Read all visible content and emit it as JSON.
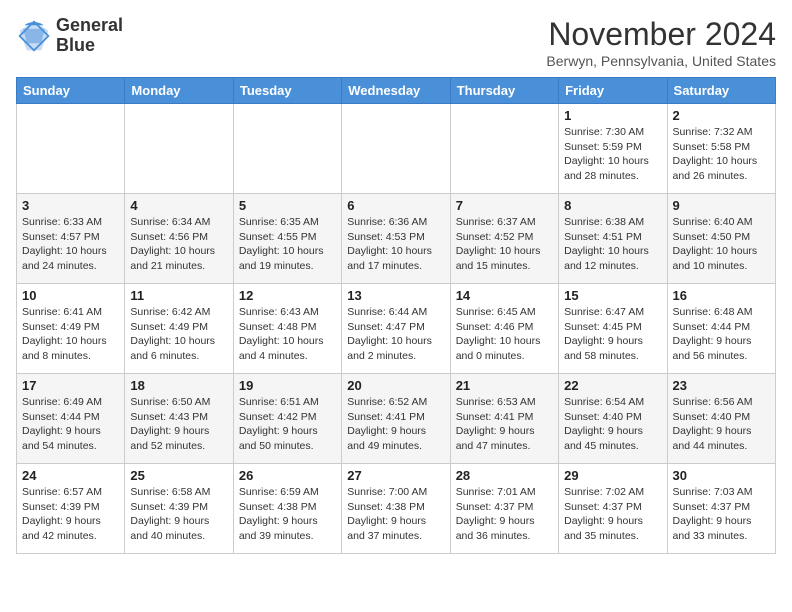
{
  "logo": {
    "line1": "General",
    "line2": "Blue"
  },
  "title": "November 2024",
  "location": "Berwyn, Pennsylvania, United States",
  "days_of_week": [
    "Sunday",
    "Monday",
    "Tuesday",
    "Wednesday",
    "Thursday",
    "Friday",
    "Saturday"
  ],
  "weeks": [
    [
      {
        "day": "",
        "info": ""
      },
      {
        "day": "",
        "info": ""
      },
      {
        "day": "",
        "info": ""
      },
      {
        "day": "",
        "info": ""
      },
      {
        "day": "",
        "info": ""
      },
      {
        "day": "1",
        "info": "Sunrise: 7:30 AM\nSunset: 5:59 PM\nDaylight: 10 hours and 28 minutes."
      },
      {
        "day": "2",
        "info": "Sunrise: 7:32 AM\nSunset: 5:58 PM\nDaylight: 10 hours and 26 minutes."
      }
    ],
    [
      {
        "day": "3",
        "info": "Sunrise: 6:33 AM\nSunset: 4:57 PM\nDaylight: 10 hours and 24 minutes."
      },
      {
        "day": "4",
        "info": "Sunrise: 6:34 AM\nSunset: 4:56 PM\nDaylight: 10 hours and 21 minutes."
      },
      {
        "day": "5",
        "info": "Sunrise: 6:35 AM\nSunset: 4:55 PM\nDaylight: 10 hours and 19 minutes."
      },
      {
        "day": "6",
        "info": "Sunrise: 6:36 AM\nSunset: 4:53 PM\nDaylight: 10 hours and 17 minutes."
      },
      {
        "day": "7",
        "info": "Sunrise: 6:37 AM\nSunset: 4:52 PM\nDaylight: 10 hours and 15 minutes."
      },
      {
        "day": "8",
        "info": "Sunrise: 6:38 AM\nSunset: 4:51 PM\nDaylight: 10 hours and 12 minutes."
      },
      {
        "day": "9",
        "info": "Sunrise: 6:40 AM\nSunset: 4:50 PM\nDaylight: 10 hours and 10 minutes."
      }
    ],
    [
      {
        "day": "10",
        "info": "Sunrise: 6:41 AM\nSunset: 4:49 PM\nDaylight: 10 hours and 8 minutes."
      },
      {
        "day": "11",
        "info": "Sunrise: 6:42 AM\nSunset: 4:49 PM\nDaylight: 10 hours and 6 minutes."
      },
      {
        "day": "12",
        "info": "Sunrise: 6:43 AM\nSunset: 4:48 PM\nDaylight: 10 hours and 4 minutes."
      },
      {
        "day": "13",
        "info": "Sunrise: 6:44 AM\nSunset: 4:47 PM\nDaylight: 10 hours and 2 minutes."
      },
      {
        "day": "14",
        "info": "Sunrise: 6:45 AM\nSunset: 4:46 PM\nDaylight: 10 hours and 0 minutes."
      },
      {
        "day": "15",
        "info": "Sunrise: 6:47 AM\nSunset: 4:45 PM\nDaylight: 9 hours and 58 minutes."
      },
      {
        "day": "16",
        "info": "Sunrise: 6:48 AM\nSunset: 4:44 PM\nDaylight: 9 hours and 56 minutes."
      }
    ],
    [
      {
        "day": "17",
        "info": "Sunrise: 6:49 AM\nSunset: 4:44 PM\nDaylight: 9 hours and 54 minutes."
      },
      {
        "day": "18",
        "info": "Sunrise: 6:50 AM\nSunset: 4:43 PM\nDaylight: 9 hours and 52 minutes."
      },
      {
        "day": "19",
        "info": "Sunrise: 6:51 AM\nSunset: 4:42 PM\nDaylight: 9 hours and 50 minutes."
      },
      {
        "day": "20",
        "info": "Sunrise: 6:52 AM\nSunset: 4:41 PM\nDaylight: 9 hours and 49 minutes."
      },
      {
        "day": "21",
        "info": "Sunrise: 6:53 AM\nSunset: 4:41 PM\nDaylight: 9 hours and 47 minutes."
      },
      {
        "day": "22",
        "info": "Sunrise: 6:54 AM\nSunset: 4:40 PM\nDaylight: 9 hours and 45 minutes."
      },
      {
        "day": "23",
        "info": "Sunrise: 6:56 AM\nSunset: 4:40 PM\nDaylight: 9 hours and 44 minutes."
      }
    ],
    [
      {
        "day": "24",
        "info": "Sunrise: 6:57 AM\nSunset: 4:39 PM\nDaylight: 9 hours and 42 minutes."
      },
      {
        "day": "25",
        "info": "Sunrise: 6:58 AM\nSunset: 4:39 PM\nDaylight: 9 hours and 40 minutes."
      },
      {
        "day": "26",
        "info": "Sunrise: 6:59 AM\nSunset: 4:38 PM\nDaylight: 9 hours and 39 minutes."
      },
      {
        "day": "27",
        "info": "Sunrise: 7:00 AM\nSunset: 4:38 PM\nDaylight: 9 hours and 37 minutes."
      },
      {
        "day": "28",
        "info": "Sunrise: 7:01 AM\nSunset: 4:37 PM\nDaylight: 9 hours and 36 minutes."
      },
      {
        "day": "29",
        "info": "Sunrise: 7:02 AM\nSunset: 4:37 PM\nDaylight: 9 hours and 35 minutes."
      },
      {
        "day": "30",
        "info": "Sunrise: 7:03 AM\nSunset: 4:37 PM\nDaylight: 9 hours and 33 minutes."
      }
    ]
  ]
}
